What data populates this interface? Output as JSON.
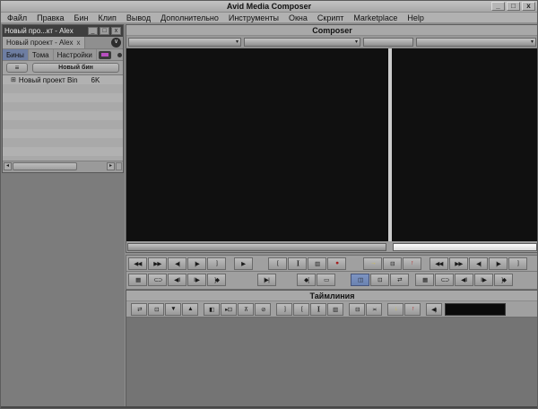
{
  "window": {
    "title": "Avid Media Composer",
    "minimize_glyph": "_",
    "maximize_glyph": "□",
    "close_glyph": "x"
  },
  "menu": {
    "items": [
      {
        "name": "menu-file",
        "label": "Файл"
      },
      {
        "name": "menu-edit",
        "label": "Правка"
      },
      {
        "name": "menu-bin",
        "label": "Бин"
      },
      {
        "name": "menu-clip",
        "label": "Клип"
      },
      {
        "name": "menu-output",
        "label": "Вывод"
      },
      {
        "name": "menu-advanced",
        "label": "Дополнительно"
      },
      {
        "name": "menu-tools",
        "label": "Инструменты"
      },
      {
        "name": "menu-windows",
        "label": "Окна"
      },
      {
        "name": "menu-script",
        "label": "Скрипт"
      },
      {
        "name": "menu-marketplace",
        "label": "Marketplace"
      },
      {
        "name": "menu-help",
        "label": "Help"
      }
    ]
  },
  "project_window": {
    "title": "Новый про...кт - Alex",
    "minimize_glyph": "_",
    "maximize_glyph": "□",
    "close_glyph": "x",
    "tab_label": "Новый проект - Alex",
    "tab_close_glyph": "x",
    "quick_menu_glyph": "∨",
    "subtabs": [
      {
        "label": "Бины"
      },
      {
        "label": "Тома"
      },
      {
        "label": "Настройки"
      }
    ],
    "fast_menu_glyph": "≡",
    "new_bin_label": "Новый бин",
    "bin_icon_glyph": "⊞",
    "bins": [
      {
        "name": "Новый проект Bin",
        "info": "6K"
      }
    ],
    "scrollbar_left_glyph": "◂",
    "scrollbar_right_glyph": "▸"
  },
  "composer": {
    "title": "Composer",
    "dropdown_arrow": "▾"
  },
  "transport": {
    "row1_g1": [
      {
        "name": "rewind-button",
        "glyph": "◀◀"
      },
      {
        "name": "fast-forward-button",
        "glyph": "▶▶"
      },
      {
        "name": "step-backward-button",
        "glyph": "◀|"
      },
      {
        "name": "step-forward-button",
        "glyph": "|▶"
      },
      {
        "name": "mark-out-button",
        "glyph": "]"
      }
    ],
    "row1_g2": [
      {
        "name": "play-button",
        "glyph": "▶"
      }
    ],
    "row1_g3": [
      {
        "name": "mark-in-button",
        "glyph": "["
      },
      {
        "name": "mark-clip-button",
        "glyph": "]["
      },
      {
        "name": "play-to-out-button",
        "glyph": "▥"
      },
      {
        "name": "record-button",
        "glyph": "●",
        "color": "#a51d1d"
      }
    ],
    "row1_g4": [
      {
        "name": "splice-in-button",
        "glyph": "→",
        "color": "#d8c23a"
      },
      {
        "name": "extract-button",
        "glyph": "⊟"
      },
      {
        "name": "lift-button",
        "glyph": "↑",
        "color": "#b22222"
      }
    ],
    "row1_g5": [
      {
        "name": "rewind-right-button",
        "glyph": "◀◀"
      },
      {
        "name": "fast-forward-right-button",
        "glyph": "▶▶"
      },
      {
        "name": "step-backward-right-button",
        "glyph": "◀|"
      },
      {
        "name": "step-forward-right-button",
        "glyph": "|▶"
      },
      {
        "name": "mark-out-right-button",
        "glyph": "]"
      }
    ],
    "row2_g1": [
      {
        "name": "video-quality-button",
        "glyph": "▦"
      },
      {
        "name": "gang-button",
        "glyph": "⊂⊃"
      },
      {
        "name": "trim-a-side-button",
        "glyph": "◀‖"
      },
      {
        "name": "trim-b-side-button",
        "glyph": "‖▶"
      },
      {
        "name": "go-to-out-button",
        "glyph": "]◆"
      }
    ],
    "row2_g2": [
      {
        "name": "play-in-to-out-button",
        "glyph": "|▶|"
      }
    ],
    "row2_g3": [
      {
        "name": "go-to-in-button",
        "glyph": "◆["
      },
      {
        "name": "add-edit-button",
        "glyph": "▭"
      }
    ],
    "row2_g4": [
      {
        "name": "toggle-source-record-button",
        "glyph": "◫",
        "active": true
      },
      {
        "name": "segment-mode-button",
        "glyph": "⊡"
      },
      {
        "name": "trim-mode-button",
        "glyph": "⇄"
      }
    ],
    "row2_g5": [
      {
        "name": "video-quality-right-button",
        "glyph": "▦"
      },
      {
        "name": "gang-right-button",
        "glyph": "⊂⊃"
      },
      {
        "name": "trim-a-side-right-button",
        "glyph": "◀‖"
      },
      {
        "name": "trim-b-side-right-button",
        "glyph": "‖▶"
      },
      {
        "name": "go-to-out-right-button",
        "glyph": "]◆"
      }
    ]
  },
  "timeline": {
    "title": "Таймлиния",
    "toolbar_g1": [
      {
        "name": "timeline-trim-mode-button",
        "glyph": "⇄"
      },
      {
        "name": "timeline-segment-mode-button",
        "glyph": "⊡"
      },
      {
        "name": "segment-overwrite-button",
        "glyph": "▼"
      },
      {
        "name": "segment-splice-button",
        "glyph": "▲"
      }
    ],
    "toolbar_g2": [
      {
        "name": "effect-mode-button",
        "glyph": "◧"
      },
      {
        "name": "motion-effect-button",
        "glyph": "▸⊡"
      },
      {
        "name": "render-effect-button",
        "glyph": "⊼"
      },
      {
        "name": "remove-effect-button",
        "glyph": "⊘"
      }
    ],
    "toolbar_g3": [
      {
        "name": "timeline-mark-out-button",
        "glyph": "]"
      },
      {
        "name": "timeline-mark-in-button",
        "glyph": "["
      },
      {
        "name": "timeline-mark-clip-button",
        "glyph": "]["
      },
      {
        "name": "clear-marks-button",
        "glyph": "▥"
      }
    ],
    "toolbar_g4": [
      {
        "name": "timeline-extract-button",
        "glyph": "⊟"
      },
      {
        "name": "trim-rollers-button",
        "glyph": "≍"
      }
    ],
    "toolbar_g5": [
      {
        "name": "yellow-arrow-tool-button",
        "glyph": "↓",
        "color": "#d8c23a"
      },
      {
        "name": "red-arrow-tool-button",
        "glyph": "↑",
        "color": "#b22222"
      }
    ],
    "toolbar_g6": [
      {
        "name": "audio-monitor-button",
        "glyph": "◀)"
      }
    ]
  },
  "accents": {
    "active_button_blue": "#6f87b8",
    "subtab_active_blue": "#6e7ea2",
    "fast_menu_magenta": "#b84fc0",
    "record_red": "#a51d1d",
    "splice_yellow": "#d8c23a",
    "monitor_black": "#101010"
  }
}
